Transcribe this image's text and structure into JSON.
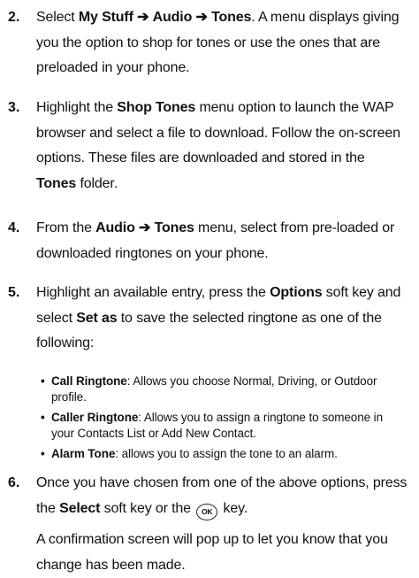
{
  "steps": [
    {
      "number": "2.",
      "parts": {
        "t1": "Select ",
        "b1": "My Stuff",
        "arrow1": "➔",
        "b2": "Audio",
        "arrow2": "➔",
        "b3": "Tones",
        "t2": ". A menu displays giving you the option to shop for tones or use the ones that are preloaded in your phone."
      }
    },
    {
      "number": "3.",
      "parts": {
        "t1": "Highlight the ",
        "b1": "Shop Tones",
        "t2": " menu option to launch the WAP browser and select a file to download. Follow the on-screen options. These files are downloaded and stored in the ",
        "b2": "Tones",
        "t3": " folder."
      }
    },
    {
      "number": "4.",
      "parts": {
        "t1": "From the ",
        "b1": "Audio",
        "arrow1": "➔",
        "b2": "Tones",
        "t2": " menu, select from pre-loaded or downloaded ringtones on your phone."
      }
    },
    {
      "number": "5.",
      "parts": {
        "t1": "Highlight an available entry, press the ",
        "b1": "Options",
        "t2": " soft key and select ",
        "b2": "Set as",
        "t3": " to save the selected ringtone as one of the following:"
      },
      "bullets": [
        {
          "term": "Call Ringtone",
          "text": ": Allows you choose Normal, Driving, or Outdoor profile."
        },
        {
          "term": "Caller Ringtone",
          "text": ": Allows you to assign a ringtone to someone in your Contacts List or Add New Contact."
        },
        {
          "term": "Alarm Tone",
          "text": ": allows you to assign the tone to an alarm."
        }
      ]
    },
    {
      "number": "6.",
      "parts": {
        "t1": "Once you have chosen from one of the above options, press the ",
        "b1": "Select",
        "t2": " soft key or the ",
        "key_label": "OK",
        "t3": " key."
      },
      "note": "A confirmation screen will pop up to let you know that you change has been made."
    }
  ],
  "bullet_symbol": "•"
}
